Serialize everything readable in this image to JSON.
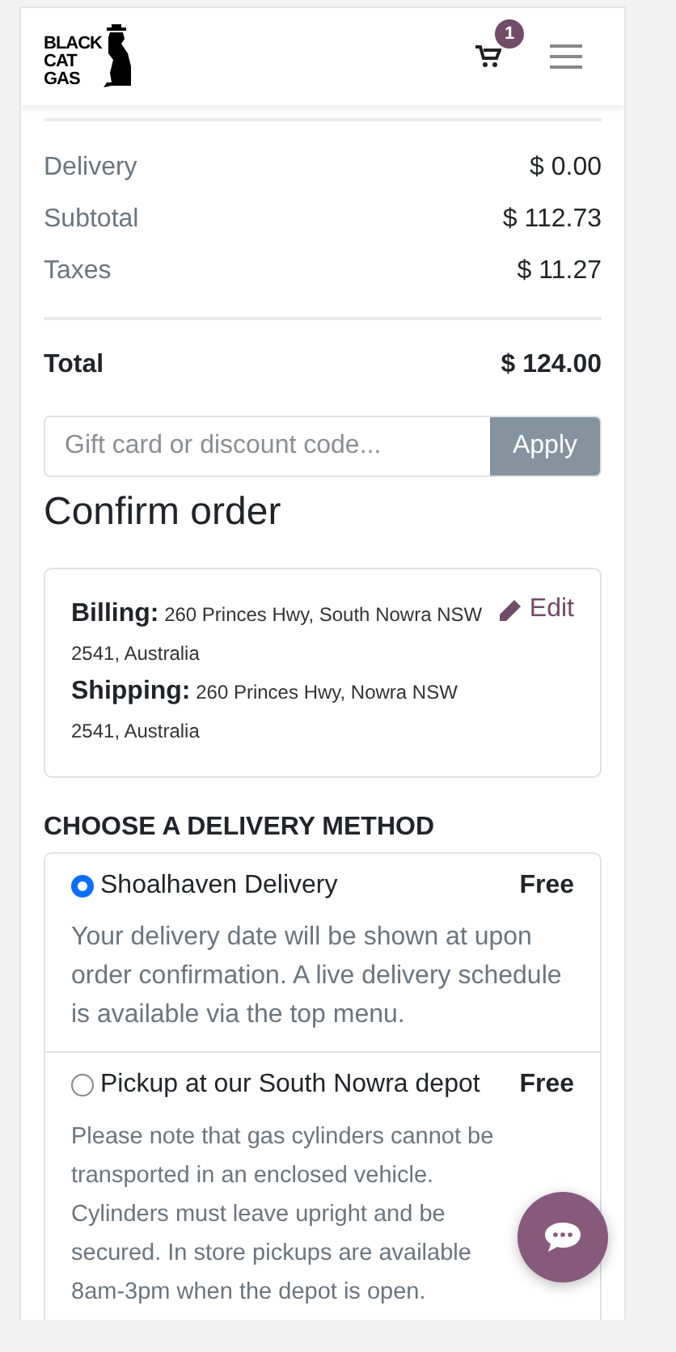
{
  "header": {
    "logo_lines": [
      "BLACK",
      "CAT",
      "GAS"
    ],
    "cart_count": "1"
  },
  "summary": [
    {
      "label": "Delivery",
      "amount": "$ 0.00"
    },
    {
      "label": "Subtotal",
      "amount": "$ 112.73"
    },
    {
      "label": "Taxes",
      "amount": "$ 11.27"
    }
  ],
  "total": {
    "label": "Total",
    "amount": "$ 124.00"
  },
  "promo": {
    "placeholder": "Gift card or discount code...",
    "button": "Apply"
  },
  "title": "Confirm order",
  "addresses": {
    "edit": "Edit",
    "lines": [
      {
        "label": "Billing:",
        "value": "260 Princes Hwy, South Nowra NSW 2541, Australia"
      },
      {
        "label": "Shipping:",
        "value": "260 Princes Hwy, Nowra NSW 2541, Australia"
      }
    ]
  },
  "delivery_heading": "CHOOSE A DELIVERY METHOD",
  "delivery_methods": [
    {
      "name": "Shoalhaven Delivery",
      "price": "Free",
      "selected": true,
      "description": "Your delivery date will be shown at upon order confirmation. A live delivery schedule is available via the top menu."
    },
    {
      "name": "Pickup at our South Nowra depot",
      "price": "Free",
      "selected": false,
      "description": "Please note that gas cylinders cannot be transported in an enclosed vehicle. Cylinders must leave upright and be secured. In store pickups are available 8am-3pm when the depot is open."
    }
  ]
}
